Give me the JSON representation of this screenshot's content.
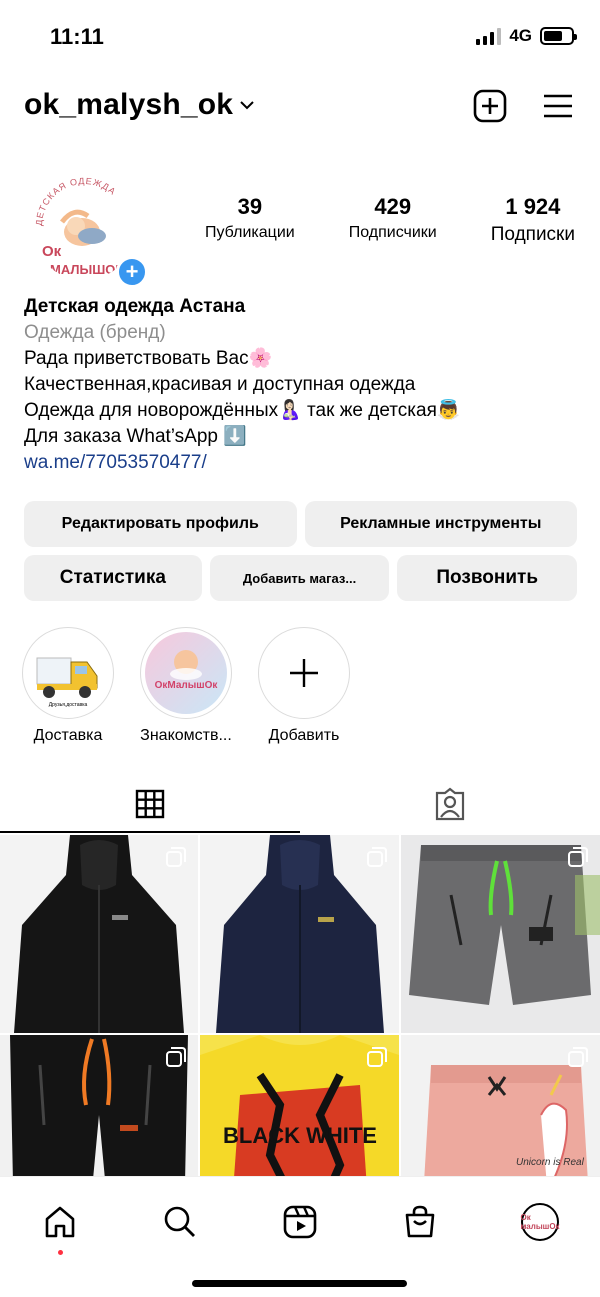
{
  "status_bar": {
    "time": "11:11",
    "network": "4G"
  },
  "header": {
    "username": "ok_malysh_ok",
    "username_menu_icon": "chevron-down-icon",
    "create_icon": "plus-square-icon",
    "menu_icon": "hamburger-icon"
  },
  "profile": {
    "avatar_top_text": "ДЕТСКАЯ ОДЕЖДА",
    "avatar_brand_line1": "Ок",
    "avatar_brand_line2": "МАЛЫШОК",
    "stats": [
      {
        "value": "39",
        "label": "Публикации"
      },
      {
        "value": "429",
        "label": "Подписчики"
      },
      {
        "value": "1 924",
        "label": "Подписки"
      }
    ],
    "bio": {
      "name": "Детская одежда Астана",
      "category": "Одежда (бренд)",
      "lines": [
        "Рада приветствовать Вас🌸",
        "Качественная,красивая и доступная одежда",
        "Одежда для новорождённых🤱🏻 так же детская👼",
        "Для заказа What’sApp ⬇️"
      ],
      "link": "wa.me/77053570477/"
    }
  },
  "buttons": {
    "edit_profile": "Редактировать профиль",
    "ad_tools": "Рекламные инструменты",
    "stats": "Статистика",
    "add_shop": "Добавить магаз...",
    "call": "Позвонить"
  },
  "highlights": [
    {
      "label": "Доставка"
    },
    {
      "label": "Знакомств..."
    },
    {
      "label": "Добавить"
    }
  ],
  "highlight_texts": {
    "truck_caption": "Друзья,доставка",
    "logo_caption": "ОкМалышОк"
  },
  "tabs": {
    "grid_icon": "grid-icon",
    "tagged_icon": "tagged-person-icon"
  },
  "posts": [
    {
      "desc": "black-jacket"
    },
    {
      "desc": "navy-jacket"
    },
    {
      "desc": "grey-shorts"
    },
    {
      "desc": "black-pants"
    },
    {
      "desc": "yellow-tshirt",
      "print": "BLACK WHITE"
    },
    {
      "desc": "pink-shorts",
      "print": "Unicorn is Real"
    }
  ],
  "bottom_nav": {
    "avatar_text": "Ок малышОк"
  },
  "colors": {
    "accent_blue": "#3897f0",
    "link": "#1a3e8a",
    "button_bg": "#efefef",
    "notif_dot": "#ff3040"
  }
}
